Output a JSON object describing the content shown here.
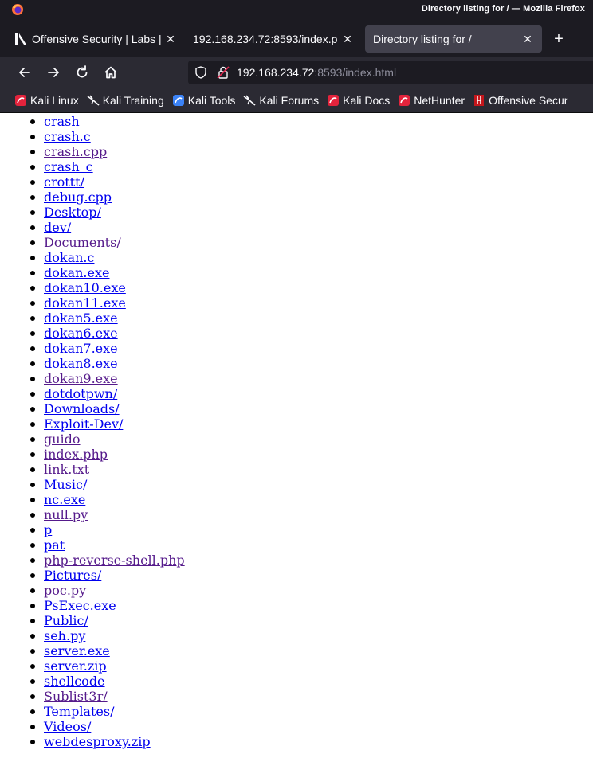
{
  "window": {
    "title": "Directory listing for / — Mozilla Firefox"
  },
  "tabs": [
    {
      "label": "Offensive Security | Labs |",
      "active": false
    },
    {
      "label": "192.168.234.72:8593/index.p",
      "active": false
    },
    {
      "label": "Directory listing for /",
      "active": true
    }
  ],
  "nav": {
    "url_host": "192.168.234.72",
    "url_rest": ":8593/index.html"
  },
  "bookmarks": [
    {
      "label": "Kali Linux",
      "icon": "kali-linux-icon"
    },
    {
      "label": "Kali Training",
      "icon": "kali-dragon-icon"
    },
    {
      "label": "Kali Tools",
      "icon": "kali-tools-icon"
    },
    {
      "label": "Kali Forums",
      "icon": "kali-dragon-icon"
    },
    {
      "label": "Kali Docs",
      "icon": "kali-linux-icon"
    },
    {
      "label": "NetHunter",
      "icon": "kali-linux-icon"
    },
    {
      "label": "Offensive Secur",
      "icon": "offsec-icon"
    }
  ],
  "listing": [
    {
      "name": "crash",
      "visited": false
    },
    {
      "name": "crash.c",
      "visited": false
    },
    {
      "name": "crash.cpp",
      "visited": true
    },
    {
      "name": "crash_c",
      "visited": false
    },
    {
      "name": "crottt/",
      "visited": false
    },
    {
      "name": "debug.cpp",
      "visited": false
    },
    {
      "name": "Desktop/",
      "visited": false
    },
    {
      "name": "dev/",
      "visited": false
    },
    {
      "name": "Documents/",
      "visited": true
    },
    {
      "name": "dokan.c",
      "visited": false
    },
    {
      "name": "dokan.exe",
      "visited": false
    },
    {
      "name": "dokan10.exe",
      "visited": false
    },
    {
      "name": "dokan11.exe",
      "visited": false
    },
    {
      "name": "dokan5.exe",
      "visited": false
    },
    {
      "name": "dokan6.exe",
      "visited": false
    },
    {
      "name": "dokan7.exe",
      "visited": false
    },
    {
      "name": "dokan8.exe",
      "visited": false
    },
    {
      "name": "dokan9.exe",
      "visited": true
    },
    {
      "name": "dotdotpwn/",
      "visited": false
    },
    {
      "name": "Downloads/",
      "visited": false
    },
    {
      "name": "Exploit-Dev/",
      "visited": false
    },
    {
      "name": "guido",
      "visited": true
    },
    {
      "name": "index.php",
      "visited": true
    },
    {
      "name": "link.txt",
      "visited": true
    },
    {
      "name": "Music/",
      "visited": false
    },
    {
      "name": "nc.exe",
      "visited": false
    },
    {
      "name": "null.py",
      "visited": true
    },
    {
      "name": "p",
      "visited": false
    },
    {
      "name": "pat",
      "visited": false
    },
    {
      "name": "php-reverse-shell.php",
      "visited": true
    },
    {
      "name": "Pictures/",
      "visited": false
    },
    {
      "name": "poc.py",
      "visited": true
    },
    {
      "name": "PsExec.exe",
      "visited": false
    },
    {
      "name": "Public/",
      "visited": false
    },
    {
      "name": "seh.py",
      "visited": false
    },
    {
      "name": "server.exe",
      "visited": false
    },
    {
      "name": "server.zip",
      "visited": false
    },
    {
      "name": "shellcode",
      "visited": false
    },
    {
      "name": "Sublist3r/",
      "visited": true
    },
    {
      "name": "Templates/",
      "visited": false
    },
    {
      "name": "Videos/",
      "visited": false
    },
    {
      "name": "webdesproxy.zip",
      "visited": false
    }
  ],
  "colors": {
    "link": "#0000ee",
    "visited": "#551a8b",
    "chrome_dark": "#1c1b22",
    "toolbar": "#2b2a33"
  }
}
